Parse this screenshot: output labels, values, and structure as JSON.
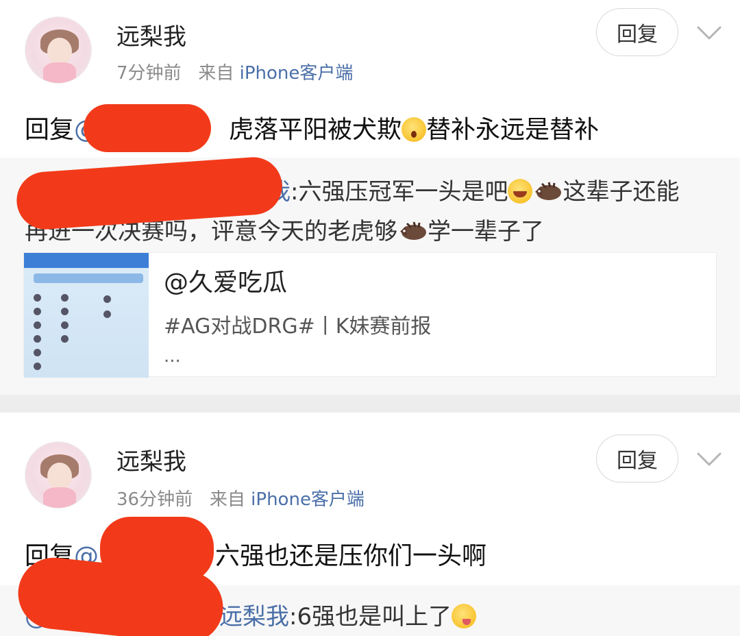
{
  "posts": [
    {
      "username": "远梨我",
      "time": "7分钟前",
      "source_prefix": "来自",
      "source": "iPhone客户端",
      "reply_label": "回复",
      "content_prefix": "回复",
      "content_mention": "@",
      "content_text": "虎落平阳被犬欺",
      "content_text2": "替补永远是替补",
      "quote_mention": "梨我",
      "quote_text1": ":六强压冠军一头是吧",
      "quote_text2": "这辈子还能",
      "quote_line2a": "再进一次决赛吗，评意今天的老虎够",
      "quote_line2b": "学一辈子了",
      "card": {
        "title": "@久爱吃瓜",
        "subtitle": "#AG对战DRG#丨K妹赛前报",
        "more": "..."
      },
      "thumb_icon": "match-lineup-thumbnail"
    },
    {
      "username": "远梨我",
      "time": "36分钟前",
      "source_prefix": "来自",
      "source": "iPhone客户端",
      "reply_label": "回复",
      "content_prefix": "回复",
      "content_mention": "@",
      "content_text": "六强也还是压你们一头啊",
      "quote_mention_prefix": "@",
      "quote_mention": "远梨我",
      "quote_text1": ":6强也是叫上了"
    }
  ],
  "colors": {
    "link": "#4a6fa8",
    "redaction": "#f23a1a",
    "quote_bg": "#f7f7f7",
    "separator": "#ededed"
  }
}
